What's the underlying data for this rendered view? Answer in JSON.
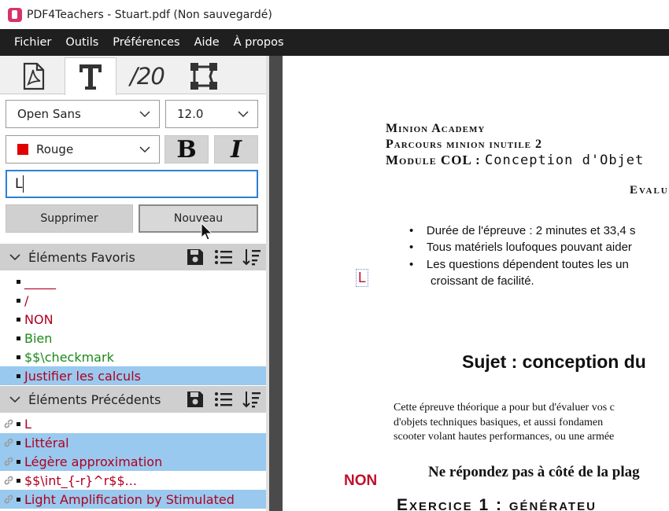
{
  "window": {
    "title": "PDF4Teachers - Stuart.pdf (Non sauvegardé)"
  },
  "menu": [
    "Fichier",
    "Outils",
    "Préférences",
    "Aide",
    "À propos"
  ],
  "tabs": [
    {
      "name": "pdf-icon",
      "active": false
    },
    {
      "name": "text-tool-icon",
      "active": true
    },
    {
      "name": "grade-tool",
      "label": "/20",
      "active": false
    },
    {
      "name": "vector-tool-icon",
      "active": false
    }
  ],
  "font": {
    "family": "Open Sans",
    "size": "12.0"
  },
  "color": {
    "label": "Rouge",
    "hex": "#e00000"
  },
  "format": {
    "bold": "B",
    "italic": "I"
  },
  "text_input": {
    "value": "L"
  },
  "buttons": {
    "delete": "Supprimer",
    "new": "Nouveau"
  },
  "favorites": {
    "title": "Éléments Favoris",
    "items": [
      {
        "text": "_____",
        "color": "#b00020",
        "selected": false
      },
      {
        "text": "/",
        "color": "#b00020",
        "selected": false
      },
      {
        "text": "NON",
        "color": "#b00020",
        "selected": false
      },
      {
        "text": "Bien",
        "color": "#1a8a1a",
        "selected": false
      },
      {
        "text": "$$\\checkmark",
        "color": "#1a8a1a",
        "selected": false
      },
      {
        "text": "Justifier les calculs",
        "color": "#b00020",
        "selected": true
      }
    ]
  },
  "previous": {
    "title": "Éléments Précédents",
    "items": [
      {
        "text": "L",
        "color": "#b00020",
        "selected": false
      },
      {
        "text": "Littéral",
        "color": "#b00020",
        "selected": true
      },
      {
        "text": "Légère approximation",
        "color": "#b00020",
        "selected": true
      },
      {
        "text": "$$\\int_{-r}^r$$...",
        "color": "#b00020",
        "selected": false
      },
      {
        "text": "Light Amplification by Stimulated",
        "color": "#b00020",
        "selected": true
      }
    ]
  },
  "document": {
    "header1": "Minion Academy",
    "header2": "Parcours minion inutile 2",
    "header3_prefix": "Module COL : ",
    "header3_rest": "Conception d'Objet",
    "eval": "Evalu",
    "bullets": [
      "Durée de l'épreuve : 2 minutes et 33,4 s",
      "Tous matériels loufoques pouvant aider",
      "Les questions dépendent toutes les un"
    ],
    "bullet_cont": "croissant de facilité.",
    "annotation_L": "L",
    "annotation_NON": "NON",
    "subject": "Sujet : conception du",
    "para": [
      "Cette épreuve théorique a pour but d'évaluer vos c",
      "d'objets techniques basiques, et aussi fondamen",
      "scooter volant hautes performances, ou une armée"
    ],
    "warning": "Ne répondez pas à côté de la plag",
    "exercise": "Exercice 1 : générateu"
  }
}
